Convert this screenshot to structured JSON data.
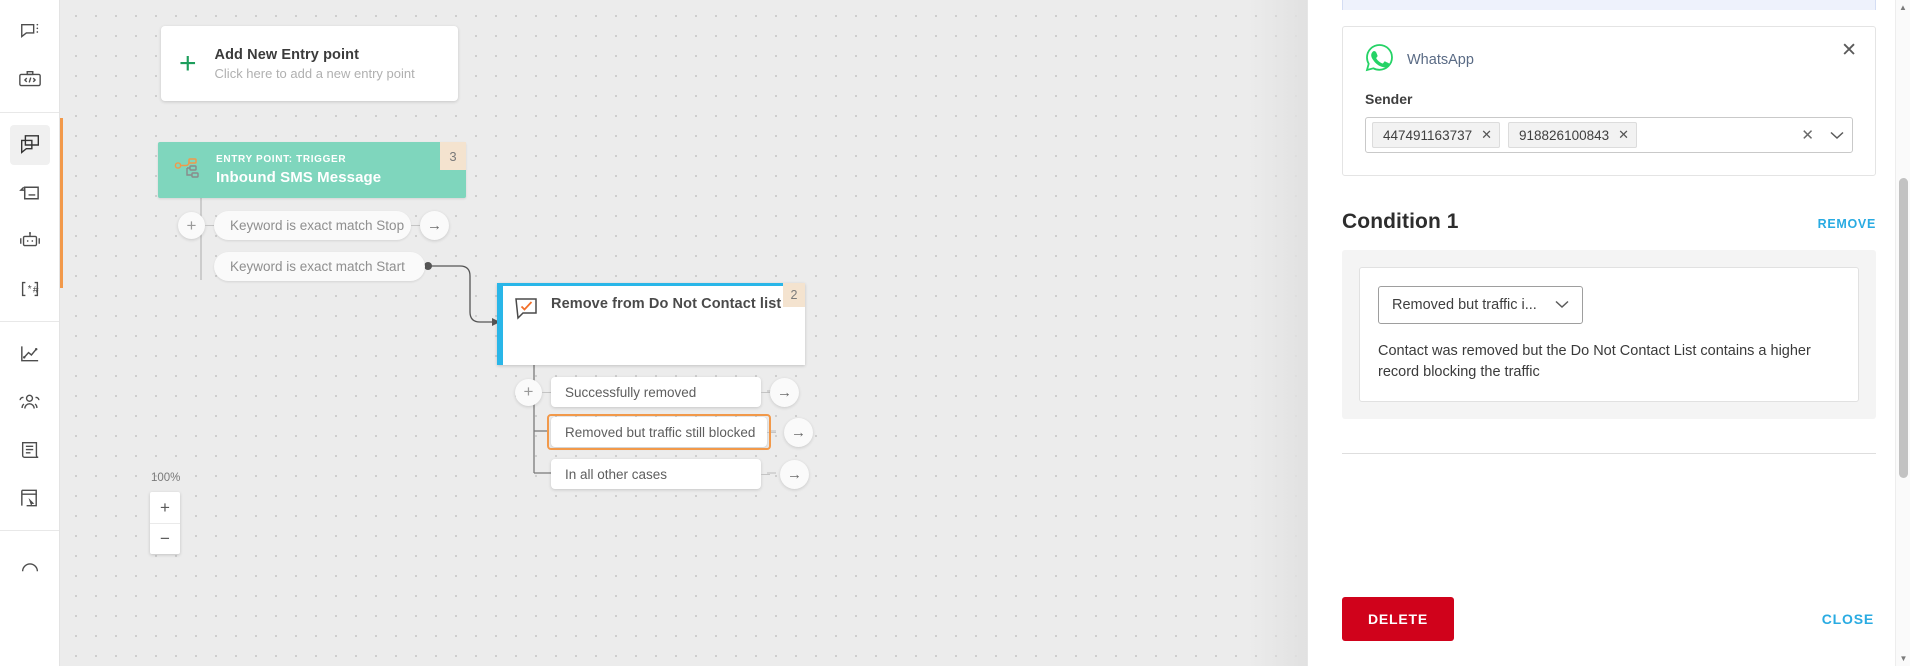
{
  "sidebar": {
    "groups": [
      {
        "items": [
          {
            "name": "messages-icon",
            "label": "Messages"
          },
          {
            "name": "code-icon",
            "label": "Developer tools"
          }
        ]
      },
      {
        "items": [
          {
            "name": "flow-icon",
            "label": "Flow",
            "active": true
          },
          {
            "name": "broadcast-icon",
            "label": "Broadcast"
          },
          {
            "name": "chatbot-icon",
            "label": "Chatbot"
          },
          {
            "name": "ussd-icon",
            "label": "USSD"
          }
        ]
      },
      {
        "items": [
          {
            "name": "analytics-icon",
            "label": "Analytics"
          },
          {
            "name": "people-icon",
            "label": "People"
          },
          {
            "name": "content-icon",
            "label": "Content"
          },
          {
            "name": "reports-icon",
            "label": "Reports"
          }
        ]
      },
      {
        "items": [
          {
            "name": "help-icon",
            "label": "Help"
          }
        ]
      }
    ]
  },
  "canvas": {
    "add_entry": {
      "title": "Add New Entry point",
      "subtitle": "Click here to add a new entry point",
      "plus": "+"
    },
    "entry_node": {
      "label": "ENTRY POINT: TRIGGER",
      "title": "Inbound SMS Message",
      "badge": "3"
    },
    "entry_branches": [
      {
        "text": "Keyword is exact match Stop",
        "has_plus": true,
        "has_arrow": true
      },
      {
        "text": "Keyword is exact match Start",
        "has_plus": false,
        "has_arrow": false
      }
    ],
    "action_node": {
      "title": "Remove from Do Not Contact list",
      "badge": "2"
    },
    "outcomes": [
      {
        "text": "Successfully removed",
        "selected": false
      },
      {
        "text": "Removed but traffic still blocked",
        "selected": true
      },
      {
        "text": "In all other cases",
        "selected": false
      }
    ],
    "zoom": {
      "percent": "100%",
      "zoom_in": "+",
      "zoom_out": "−"
    }
  },
  "panel": {
    "whatsapp": {
      "channel": "WhatsApp",
      "sender_label": "Sender",
      "senders": [
        "447491163737",
        "918826100843"
      ],
      "close": "✕",
      "clear": "✕",
      "chevron": "⌄"
    },
    "condition": {
      "title": "Condition 1",
      "remove_label": "REMOVE",
      "select_value": "Removed but traffic i...",
      "select_chevron": "⌄",
      "description": "Contact was removed but the Do Not Contact List contains a higher record blocking the traffic"
    },
    "footer": {
      "delete_label": "DELETE",
      "close_label": "CLOSE"
    }
  },
  "colors": {
    "entry_node": "#7fd6bd",
    "action_accent": "#29b6e8",
    "selection": "#f2994a",
    "delete": "#d0021b",
    "link": "#29abe2",
    "whatsapp": "#25d366"
  }
}
